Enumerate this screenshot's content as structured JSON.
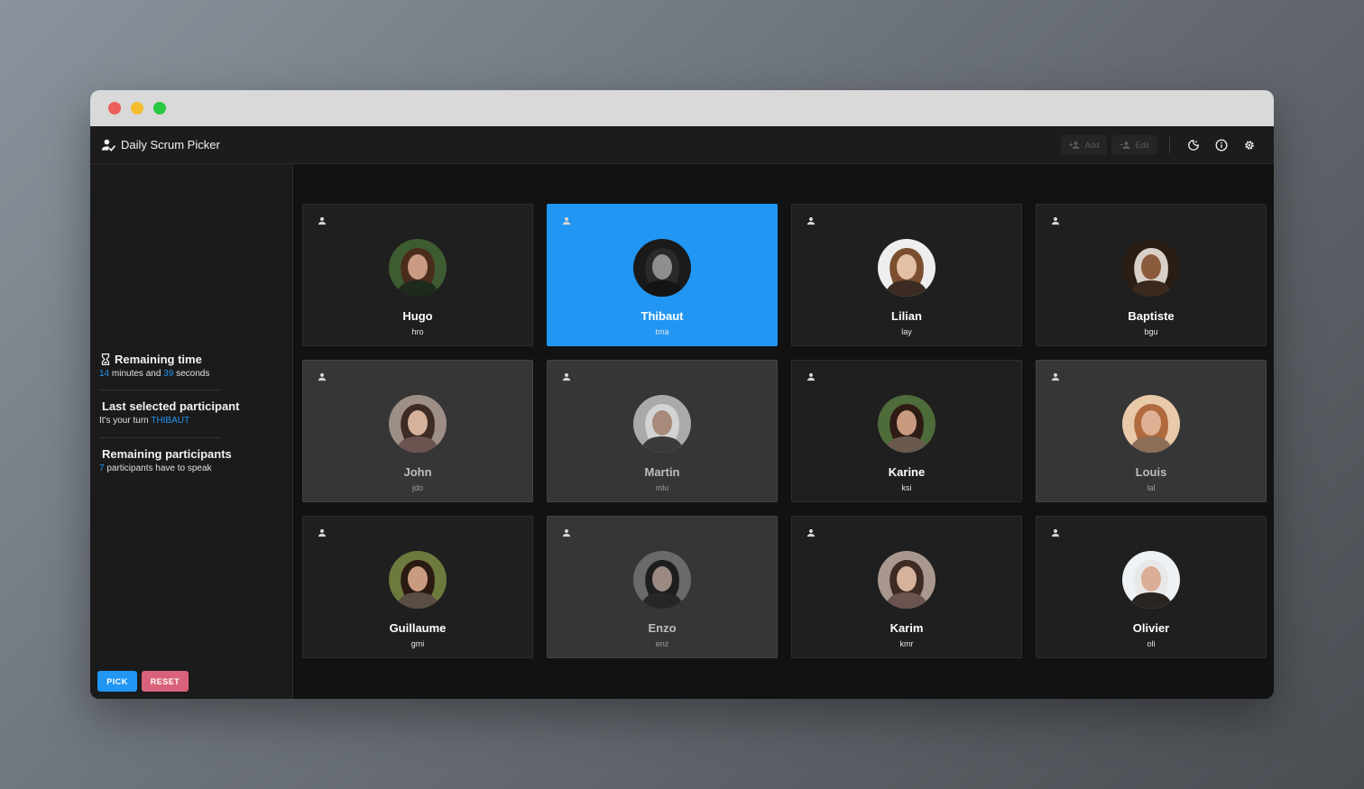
{
  "app": {
    "title": "Daily Scrum Picker"
  },
  "toolbar": {
    "add_label": "Add",
    "edit_label": "Edit"
  },
  "sidebar": {
    "remaining_time": {
      "title": "Remaining time",
      "minutes": "14",
      "minutes_label": "minutes and",
      "seconds": "39",
      "seconds_label": "seconds"
    },
    "last_selected": {
      "title": "Last selected participant",
      "prefix": "It's your turn",
      "name": "THIBAUT"
    },
    "remaining_participants": {
      "title": "Remaining participants",
      "count": "7",
      "suffix": "participants have to speak"
    },
    "pick_label": "PICK",
    "reset_label": "RESET"
  },
  "participants": [
    {
      "name": "Hugo",
      "code": "hro",
      "state": "available",
      "avatar": {
        "bg": "#3d5c32",
        "hair": "#4a2c1c",
        "skin": "#c99b82",
        "cloth": "#1e2a1c"
      }
    },
    {
      "name": "Thibaut",
      "code": "tma",
      "state": "selected",
      "avatar": {
        "bg": "#1a1a1a",
        "hair": "#2a2a2a",
        "skin": "#8e8e8e",
        "cloth": "#141414"
      }
    },
    {
      "name": "Lilian",
      "code": "lay",
      "state": "available",
      "avatar": {
        "bg": "#eeeeee",
        "hair": "#7a4e2e",
        "skin": "#e2bfa5",
        "cloth": "#3b2b22"
      }
    },
    {
      "name": "Baptiste",
      "code": "bgu",
      "state": "available",
      "avatar": {
        "bg": "#2a1d14",
        "hair": "#d8d0c8",
        "skin": "#8b5a3c",
        "cloth": "#3a2a1e"
      }
    },
    {
      "name": "John",
      "code": "jdo",
      "state": "passed",
      "avatar": {
        "bg": "#9d8f86",
        "hair": "#3d2b24",
        "skin": "#d6b29c",
        "cloth": "#6b5450"
      }
    },
    {
      "name": "Martin",
      "code": "mlu",
      "state": "passed",
      "avatar": {
        "bg": "#aaaaaa",
        "hair": "#d4d4d4",
        "skin": "#a88a7a",
        "cloth": "#3a3a3a"
      }
    },
    {
      "name": "Karine",
      "code": "ksi",
      "state": "available",
      "avatar": {
        "bg": "#4e6b3a",
        "hair": "#2e1c14",
        "skin": "#c89a80",
        "cloth": "#6a5a4e"
      }
    },
    {
      "name": "Louis",
      "code": "lal",
      "state": "passed",
      "avatar": {
        "bg": "#e8c9a8",
        "hair": "#b06a3e",
        "skin": "#e0b094",
        "cloth": "#8a6e58"
      }
    },
    {
      "name": "Guillaume",
      "code": "gmi",
      "state": "available",
      "avatar": {
        "bg": "#6d7a3e",
        "hair": "#2a1a12",
        "skin": "#c89a80",
        "cloth": "#5a4e44"
      }
    },
    {
      "name": "Enzo",
      "code": "enz",
      "state": "passed",
      "avatar": {
        "bg": "#6a6a6a",
        "hair": "#1e1e1e",
        "skin": "#9a8a82",
        "cloth": "#262626"
      }
    },
    {
      "name": "Karim",
      "code": "kmr",
      "state": "available",
      "avatar": {
        "bg": "#a9988e",
        "hair": "#3d2b24",
        "skin": "#d6b29c",
        "cloth": "#6b5450"
      }
    },
    {
      "name": "Olivier",
      "code": "oli",
      "state": "available",
      "avatar": {
        "bg": "#eef2f4",
        "hair": "#e8e8e8",
        "skin": "#d9ad96",
        "cloth": "#2a2420"
      }
    }
  ]
}
